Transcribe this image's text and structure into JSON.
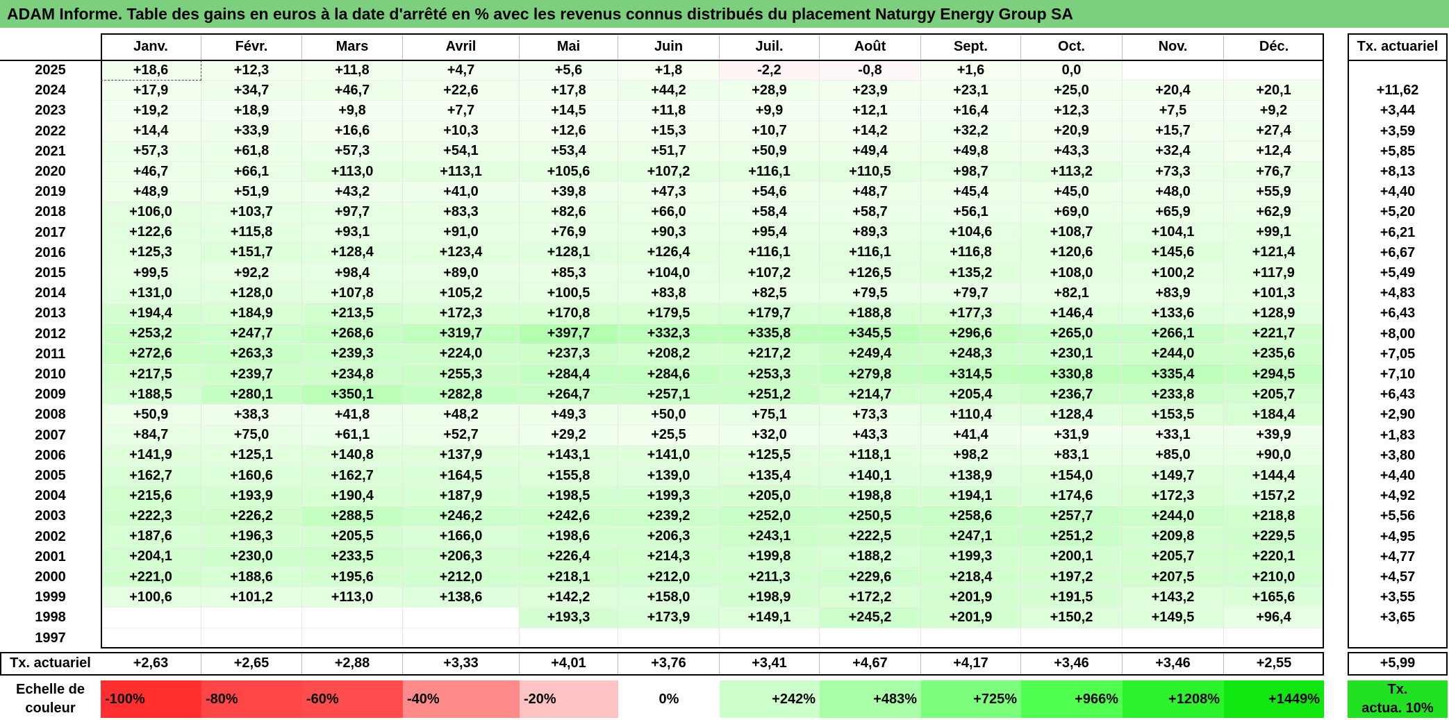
{
  "title": "ADAM Informe. Table des gains en euros à la date d'arrêté en % avec les revenus connus distribués du placement Naturgy Energy Group SA",
  "chart_data": {
    "type": "table",
    "columns": [
      "Janv.",
      "Févr.",
      "Mars",
      "Avril",
      "Mai",
      "Juin",
      "Juil.",
      "Août",
      "Sept.",
      "Oct.",
      "Nov.",
      "Déc."
    ],
    "right_header": "Tx. actuariel",
    "rows": [
      {
        "year": "2025",
        "values": [
          "+18,6",
          "+12,3",
          "+11,8",
          "+4,7",
          "+5,6",
          "+1,8",
          "-2,2",
          "-0,8",
          "+1,6",
          "0,0",
          "",
          ""
        ],
        "tx": ""
      },
      {
        "year": "2024",
        "values": [
          "+17,9",
          "+34,7",
          "+46,7",
          "+22,6",
          "+17,8",
          "+44,2",
          "+28,9",
          "+23,9",
          "+23,1",
          "+25,0",
          "+20,4",
          "+20,1"
        ],
        "tx": "+11,62"
      },
      {
        "year": "2023",
        "values": [
          "+19,2",
          "+18,9",
          "+9,8",
          "+7,7",
          "+14,5",
          "+11,8",
          "+9,9",
          "+12,1",
          "+16,4",
          "+12,3",
          "+7,5",
          "+9,2"
        ],
        "tx": "+3,44"
      },
      {
        "year": "2022",
        "values": [
          "+14,4",
          "+33,9",
          "+16,6",
          "+10,3",
          "+12,6",
          "+15,3",
          "+10,7",
          "+14,2",
          "+32,2",
          "+20,9",
          "+15,7",
          "+27,4"
        ],
        "tx": "+3,59"
      },
      {
        "year": "2021",
        "values": [
          "+57,3",
          "+61,8",
          "+57,3",
          "+54,1",
          "+53,4",
          "+51,7",
          "+50,9",
          "+49,4",
          "+49,8",
          "+43,3",
          "+32,4",
          "+12,4"
        ],
        "tx": "+5,85"
      },
      {
        "year": "2020",
        "values": [
          "+46,7",
          "+66,1",
          "+113,0",
          "+113,1",
          "+105,6",
          "+107,2",
          "+116,1",
          "+110,5",
          "+98,7",
          "+113,2",
          "+73,3",
          "+76,7"
        ],
        "tx": "+8,13"
      },
      {
        "year": "2019",
        "values": [
          "+48,9",
          "+51,9",
          "+43,2",
          "+41,0",
          "+39,8",
          "+47,3",
          "+54,6",
          "+48,7",
          "+45,4",
          "+45,0",
          "+48,0",
          "+55,9"
        ],
        "tx": "+4,40"
      },
      {
        "year": "2018",
        "values": [
          "+106,0",
          "+103,7",
          "+97,7",
          "+83,3",
          "+82,6",
          "+66,0",
          "+58,4",
          "+58,7",
          "+56,1",
          "+69,0",
          "+65,9",
          "+62,9"
        ],
        "tx": "+5,20"
      },
      {
        "year": "2017",
        "values": [
          "+122,6",
          "+115,8",
          "+93,1",
          "+91,0",
          "+76,9",
          "+90,3",
          "+95,4",
          "+89,3",
          "+104,6",
          "+108,7",
          "+104,1",
          "+99,1"
        ],
        "tx": "+6,21"
      },
      {
        "year": "2016",
        "values": [
          "+125,3",
          "+151,7",
          "+128,4",
          "+123,4",
          "+128,1",
          "+126,4",
          "+116,1",
          "+116,1",
          "+116,8",
          "+120,6",
          "+145,6",
          "+121,4"
        ],
        "tx": "+6,67"
      },
      {
        "year": "2015",
        "values": [
          "+99,5",
          "+92,2",
          "+98,4",
          "+89,0",
          "+85,3",
          "+104,0",
          "+107,2",
          "+126,5",
          "+135,2",
          "+108,0",
          "+100,2",
          "+117,9"
        ],
        "tx": "+5,49"
      },
      {
        "year": "2014",
        "values": [
          "+131,0",
          "+128,0",
          "+107,8",
          "+105,2",
          "+100,5",
          "+83,8",
          "+82,5",
          "+79,5",
          "+79,7",
          "+82,1",
          "+83,9",
          "+101,3"
        ],
        "tx": "+4,83"
      },
      {
        "year": "2013",
        "values": [
          "+194,4",
          "+184,9",
          "+213,5",
          "+172,3",
          "+170,8",
          "+179,5",
          "+179,7",
          "+188,8",
          "+177,3",
          "+146,4",
          "+133,6",
          "+128,9"
        ],
        "tx": "+6,43"
      },
      {
        "year": "2012",
        "values": [
          "+253,2",
          "+247,7",
          "+268,6",
          "+319,7",
          "+397,7",
          "+332,3",
          "+335,8",
          "+345,5",
          "+296,6",
          "+265,0",
          "+266,1",
          "+221,7"
        ],
        "tx": "+8,00"
      },
      {
        "year": "2011",
        "values": [
          "+272,6",
          "+263,3",
          "+239,3",
          "+224,0",
          "+237,3",
          "+208,2",
          "+217,2",
          "+249,4",
          "+248,3",
          "+230,1",
          "+244,0",
          "+235,6"
        ],
        "tx": "+7,05"
      },
      {
        "year": "2010",
        "values": [
          "+217,5",
          "+239,7",
          "+234,8",
          "+255,3",
          "+284,4",
          "+284,6",
          "+253,3",
          "+279,8",
          "+314,5",
          "+330,8",
          "+335,4",
          "+294,5"
        ],
        "tx": "+7,10"
      },
      {
        "year": "2009",
        "values": [
          "+188,5",
          "+280,1",
          "+350,1",
          "+282,8",
          "+264,7",
          "+257,1",
          "+251,2",
          "+214,7",
          "+205,4",
          "+236,7",
          "+233,8",
          "+205,7"
        ],
        "tx": "+6,43"
      },
      {
        "year": "2008",
        "values": [
          "+50,9",
          "+38,3",
          "+41,8",
          "+48,2",
          "+49,3",
          "+50,0",
          "+75,1",
          "+73,3",
          "+110,4",
          "+128,4",
          "+153,5",
          "+184,4"
        ],
        "tx": "+2,90"
      },
      {
        "year": "2007",
        "values": [
          "+84,7",
          "+75,0",
          "+61,1",
          "+52,7",
          "+29,2",
          "+25,5",
          "+32,0",
          "+43,3",
          "+41,4",
          "+31,9",
          "+33,1",
          "+39,9"
        ],
        "tx": "+1,83"
      },
      {
        "year": "2006",
        "values": [
          "+141,9",
          "+125,1",
          "+140,8",
          "+137,9",
          "+143,1",
          "+141,0",
          "+125,5",
          "+118,1",
          "+98,2",
          "+83,1",
          "+85,0",
          "+90,0"
        ],
        "tx": "+3,80"
      },
      {
        "year": "2005",
        "values": [
          "+162,7",
          "+160,6",
          "+162,7",
          "+164,5",
          "+155,8",
          "+139,0",
          "+135,4",
          "+140,1",
          "+138,9",
          "+154,0",
          "+149,7",
          "+144,4"
        ],
        "tx": "+4,40"
      },
      {
        "year": "2004",
        "values": [
          "+215,6",
          "+193,9",
          "+190,4",
          "+187,9",
          "+198,5",
          "+199,3",
          "+205,0",
          "+198,8",
          "+194,1",
          "+174,6",
          "+172,3",
          "+157,2"
        ],
        "tx": "+4,92"
      },
      {
        "year": "2003",
        "values": [
          "+222,3",
          "+226,2",
          "+288,5",
          "+246,2",
          "+242,6",
          "+239,2",
          "+252,0",
          "+250,5",
          "+258,6",
          "+257,7",
          "+244,0",
          "+218,8"
        ],
        "tx": "+5,56"
      },
      {
        "year": "2002",
        "values": [
          "+187,6",
          "+196,3",
          "+205,5",
          "+166,0",
          "+198,6",
          "+206,3",
          "+243,1",
          "+222,5",
          "+247,1",
          "+251,2",
          "+209,8",
          "+229,5"
        ],
        "tx": "+4,95"
      },
      {
        "year": "2001",
        "values": [
          "+204,1",
          "+230,0",
          "+233,5",
          "+206,3",
          "+226,4",
          "+214,3",
          "+199,8",
          "+188,2",
          "+199,3",
          "+200,1",
          "+205,7",
          "+220,1"
        ],
        "tx": "+4,77"
      },
      {
        "year": "2000",
        "values": [
          "+221,0",
          "+188,6",
          "+195,6",
          "+212,0",
          "+218,1",
          "+212,0",
          "+211,3",
          "+229,6",
          "+218,4",
          "+197,2",
          "+207,5",
          "+210,0"
        ],
        "tx": "+4,57"
      },
      {
        "year": "1999",
        "values": [
          "+100,6",
          "+101,2",
          "+113,0",
          "+138,6",
          "+142,2",
          "+158,0",
          "+198,9",
          "+172,2",
          "+201,9",
          "+191,5",
          "+143,2",
          "+165,6"
        ],
        "tx": "+3,55"
      },
      {
        "year": "1998",
        "values": [
          "",
          "",
          "",
          "",
          "+193,3",
          "+173,9",
          "+149,1",
          "+245,2",
          "+201,9",
          "+150,2",
          "+149,5",
          "+96,4"
        ],
        "tx": "+3,65"
      },
      {
        "year": "1997",
        "values": [
          "",
          "",
          "",
          "",
          "",
          "",
          "",
          "",
          "",
          "",
          "",
          ""
        ],
        "tx": ""
      }
    ],
    "footer": {
      "label": "Tx. actuariel",
      "values": [
        "+2,63",
        "+2,65",
        "+2,88",
        "+3,33",
        "+4,01",
        "+3,76",
        "+3,41",
        "+4,67",
        "+4,17",
        "+3,46",
        "+3,46",
        "+2,55"
      ],
      "tx": "+5,99"
    },
    "scale": {
      "label_line1": "Echelle de",
      "label_line2": "couleur",
      "steps": [
        {
          "label": "-100%",
          "color": "#ff2f2f"
        },
        {
          "label": "-80%",
          "color": "#ff4646"
        },
        {
          "label": "-60%",
          "color": "#ff4d4d"
        },
        {
          "label": "-40%",
          "color": "#ff8a8a"
        },
        {
          "label": "-20%",
          "color": "#ffc3c3"
        },
        {
          "label": "0%",
          "color": "#ffffff"
        },
        {
          "label": "+242%",
          "color": "#ccffcc"
        },
        {
          "label": "+483%",
          "color": "#a8ffa8"
        },
        {
          "label": "+725%",
          "color": "#7dff7d"
        },
        {
          "label": "+966%",
          "color": "#50ff50"
        },
        {
          "label": "+1208%",
          "color": "#2cf22c"
        },
        {
          "label": "+1449%",
          "color": "#10e610"
        }
      ],
      "tx_line1": "Tx.",
      "tx_line2": "actua. 10%",
      "tx_color": "#22e022"
    }
  }
}
